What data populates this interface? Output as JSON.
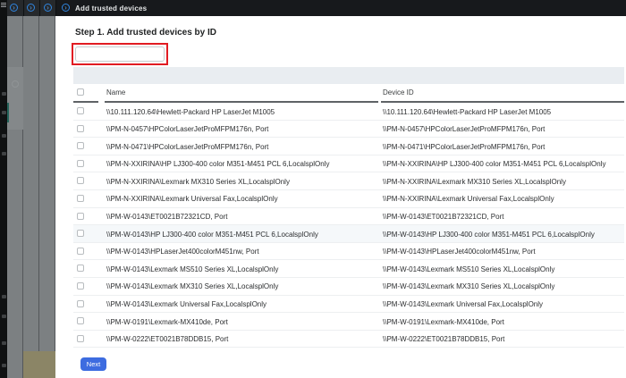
{
  "app": {
    "header_title": "Add trusted devices",
    "step_title": "Step 1. Add trusted devices by ID",
    "input_value": "",
    "next_label": "Next"
  },
  "icons": {
    "menu": "menu-hamburger",
    "panel_collapse": "›"
  },
  "table": {
    "columns": [
      "Name",
      "Device ID"
    ],
    "highlighted_row_index": 7,
    "rows": [
      {
        "name": "\\\\10.111.120.64\\Hewlett-Packard HP LaserJet M1005",
        "device_id": "\\\\10.111.120.64\\Hewlett-Packard HP LaserJet M1005"
      },
      {
        "name": "\\\\PM-N-0457\\HPColorLaserJetProMFPM176n, Port",
        "device_id": "\\\\PM-N-0457\\HPColorLaserJetProMFPM176n, Port"
      },
      {
        "name": "\\\\PM-N-0471\\HPColorLaserJetProMFPM176n, Port",
        "device_id": "\\\\PM-N-0471\\HPColorLaserJetProMFPM176n, Port"
      },
      {
        "name": "\\\\PM-N-XXIRINA\\HP LJ300-400 color M351-M451 PCL 6,LocalsplOnly",
        "device_id": "\\\\PM-N-XXIRINA\\HP LJ300-400 color M351-M451 PCL 6,LocalsplOnly"
      },
      {
        "name": "\\\\PM-N-XXIRINA\\Lexmark MX310 Series XL,LocalsplOnly",
        "device_id": "\\\\PM-N-XXIRINA\\Lexmark MX310 Series XL,LocalsplOnly"
      },
      {
        "name": "\\\\PM-N-XXIRINA\\Lexmark Universal Fax,LocalsplOnly",
        "device_id": "\\\\PM-N-XXIRINA\\Lexmark Universal Fax,LocalsplOnly"
      },
      {
        "name": "\\\\PM-W-0143\\ET0021B72321CD, Port",
        "device_id": "\\\\PM-W-0143\\ET0021B72321CD, Port"
      },
      {
        "name": "\\\\PM-W-0143\\HP LJ300-400 color M351-M451 PCL 6,LocalsplOnly",
        "device_id": "\\\\PM-W-0143\\HP LJ300-400 color M351-M451 PCL 6,LocalsplOnly"
      },
      {
        "name": "\\\\PM-W-0143\\HPLaserJet400colorM451nw, Port",
        "device_id": "\\\\PM-W-0143\\HPLaserJet400colorM451nw, Port"
      },
      {
        "name": "\\\\PM-W-0143\\Lexmark MS510 Series XL,LocalsplOnly",
        "device_id": "\\\\PM-W-0143\\Lexmark MS510 Series XL,LocalsplOnly"
      },
      {
        "name": "\\\\PM-W-0143\\Lexmark MX310 Series XL,LocalsplOnly",
        "device_id": "\\\\PM-W-0143\\Lexmark MX310 Series XL,LocalsplOnly"
      },
      {
        "name": "\\\\PM-W-0143\\Lexmark Universal Fax,LocalsplOnly",
        "device_id": "\\\\PM-W-0143\\Lexmark Universal Fax,LocalsplOnly"
      },
      {
        "name": "\\\\PM-W-0191\\Lexmark-MX410de, Port",
        "device_id": "\\\\PM-W-0191\\Lexmark-MX410de, Port"
      },
      {
        "name": "\\\\PM-W-0222\\ET0021B78DDB15, Port",
        "device_id": "\\\\PM-W-0222\\ET0021B78DDB15, Port"
      }
    ]
  },
  "colors": {
    "accent_blue": "#2f85e0",
    "highlight_red": "#e11b22",
    "button_blue": "#3d6ce0",
    "header_dark": "#17191c",
    "panel_gray": "#7c8082"
  }
}
